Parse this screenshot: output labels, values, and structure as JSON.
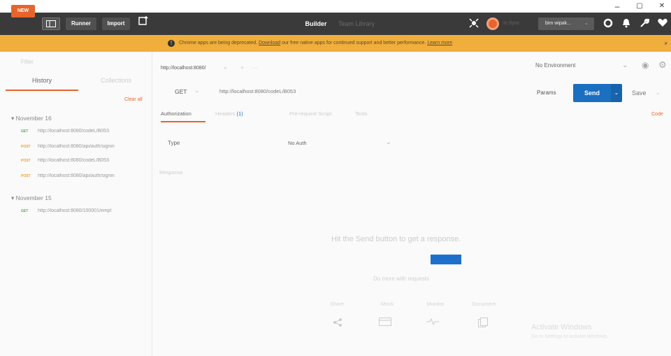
{
  "window": {
    "minimize": "–",
    "maximize": "▢",
    "close": "✕"
  },
  "toolbar": {
    "new_label": "NEW",
    "runner_label": "Runner",
    "import_label": "Import",
    "builder_tab": "Builder",
    "team_library_tab": "Team Library",
    "sync_label": "In Sync",
    "user_label": "bim wipak...",
    "accent_color": "#e8642c"
  },
  "banner": {
    "message_before": "Chrome apps are being deprecated.",
    "download_link": "Download",
    "message_after": "our free native apps for continued support and better performance.",
    "learn_more": "Learn more",
    "close": "×",
    "color": "#f0ae3c"
  },
  "sidebar": {
    "filter_placeholder": "Filter",
    "tabs": [
      "History",
      "Collections"
    ],
    "clear_all": "Clear all",
    "groups": [
      {
        "label": "November 16",
        "items": [
          {
            "method": "GET",
            "url": "http://localhost:8080/codeL/B053"
          },
          {
            "method": "POST",
            "url": "http://localhost:8080/api/auth/signin"
          },
          {
            "method": "POST",
            "url": "http://localhost:8080/codeL/B053"
          },
          {
            "method": "POST",
            "url": "http://localhost:8080/api/auth/signin"
          }
        ]
      },
      {
        "label": "November 15",
        "items": [
          {
            "method": "GET",
            "url": "http://localhost:8080/100001/empl"
          }
        ]
      }
    ]
  },
  "request": {
    "tab_title": "http://localhost:8080/",
    "tab_close": "×",
    "tab_add": "+",
    "tab_more": "···",
    "environment": "No Environment",
    "method": "GET",
    "url": "http://localhost:8080/codeL/B053",
    "params": "Params",
    "send": "Send",
    "save": "Save",
    "send_color": "#1a6fc0"
  },
  "subtabs": {
    "authorization": "Authorization",
    "headers": "Headers",
    "headers_count": "(1)",
    "prerequest": "Pre-request Script",
    "tests": "Tests",
    "code": "Code"
  },
  "auth": {
    "type_label": "Type",
    "type_value": "No Auth"
  },
  "response": {
    "label": "Response",
    "hint": "Hit the Send button to get a response.",
    "do_more": "Do more with requests",
    "actions": [
      "Share",
      "Mock",
      "Monitor",
      "Document"
    ]
  },
  "watermark": {
    "title": "Activate Windows",
    "subtitle": "Go to Settings to activate Windows."
  }
}
